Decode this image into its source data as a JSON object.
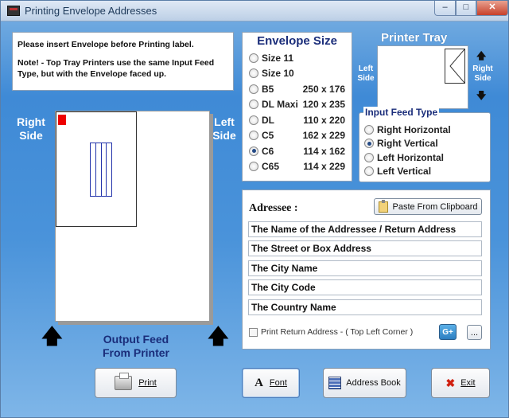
{
  "window": {
    "title": "Printing Envelope Addresses",
    "minimize": "–",
    "maximize": "□",
    "close": "✕"
  },
  "note": {
    "line1": "Please insert Envelope before Printing label.",
    "line2": "Note!  - Top Tray Printers use the same Input Feed Type, but  with the Envelope faced up."
  },
  "envelope_size": {
    "title": "Envelope Size",
    "options": [
      {
        "name": "Size 11",
        "dims": "",
        "selected": false
      },
      {
        "name": "Size 10",
        "dims": "",
        "selected": false
      },
      {
        "name": "B5",
        "dims": "250 x 176",
        "selected": false
      },
      {
        "name": "DL Maxi",
        "dims": "120 x 235",
        "selected": false
      },
      {
        "name": "DL",
        "dims": "110 x 220",
        "selected": false
      },
      {
        "name": "C5",
        "dims": "162 x 229",
        "selected": false
      },
      {
        "name": "C6",
        "dims": "114 x 162",
        "selected": true
      },
      {
        "name": "C65",
        "dims": "114 x 229",
        "selected": false
      }
    ]
  },
  "printer_tray": {
    "title": "Printer Tray",
    "left_label": "Left Side",
    "right_label": "Right Side",
    "up_arrow": "🡅",
    "down_arrow": "🡇"
  },
  "input_feed": {
    "title": "Input Feed Type",
    "options": [
      {
        "label": "Right Horizontal",
        "selected": false
      },
      {
        "label": "Right Vertical",
        "selected": true
      },
      {
        "label": "Left Horizontal",
        "selected": false
      },
      {
        "label": "Left Vertical",
        "selected": false
      }
    ]
  },
  "preview": {
    "right_side": "Right Side",
    "left_side": "Left Side",
    "output_feed": "Output Feed From Printer",
    "arrow": "🡅"
  },
  "addressee": {
    "title": "Adressee :",
    "paste_button": "Paste From Clipboard",
    "fields": [
      "The Name of the Addressee / Return Address",
      "The Street or Box Address",
      "The City Name",
      "The City Code",
      "The Country Name"
    ],
    "print_return": "Print Return Address - ( Top Left Corner )",
    "small_btn1": "G+",
    "small_btn2": "..."
  },
  "buttons": {
    "print": "Print",
    "font": "Font",
    "font_glyph": "A",
    "address_book": "Address Book",
    "exit": "Exit",
    "exit_glyph": "✖"
  }
}
